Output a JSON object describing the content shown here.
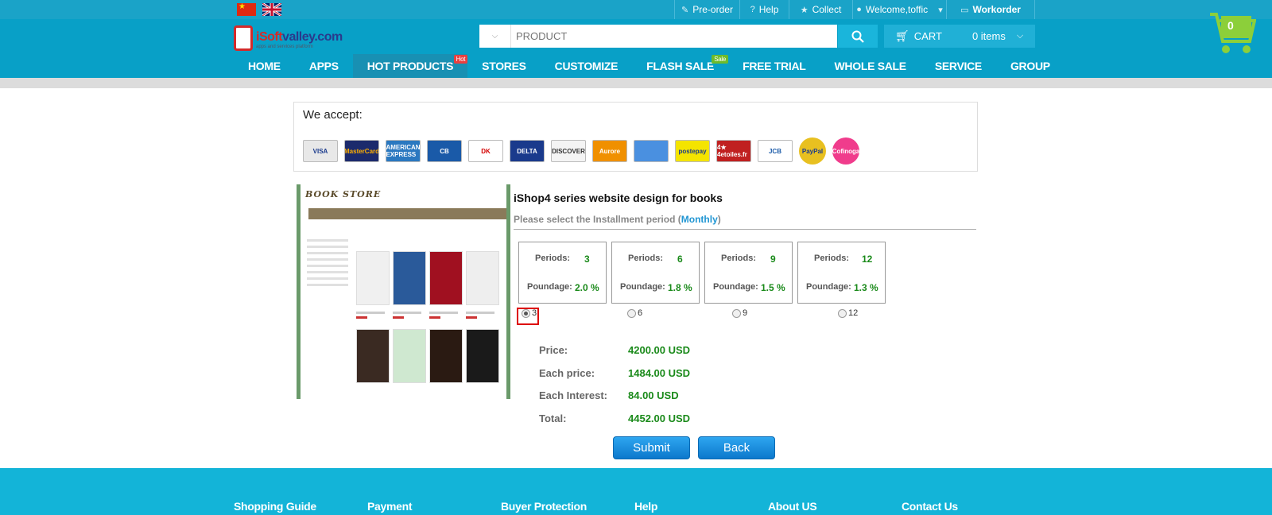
{
  "topbar": {
    "preorder": "Pre-order",
    "help": "Help",
    "collect": "Collect",
    "welcome": "Welcome,toffic",
    "workorder": "Workorder"
  },
  "brand": {
    "name_prefix": "iSoft",
    "name_rest": "valley.com",
    "tagline": "apps and services platform"
  },
  "search": {
    "placeholder": "PRODUCT"
  },
  "cart": {
    "label": "CART",
    "items": "0 items",
    "count": "0"
  },
  "nav": {
    "items": [
      "HOME",
      "APPS",
      "HOT PRODUCTS",
      "STORES",
      "CUSTOMIZE",
      "FLASH SALE",
      "FREE TRIAL",
      "WHOLE SALE",
      "SERVICE",
      "GROUP"
    ],
    "hot_badge": "Hot",
    "sale_badge": "Sale"
  },
  "accept": {
    "title": "We accept:",
    "cards": [
      {
        "label": "VISA",
        "color": "#e8e8e8",
        "text": "#1a3a8c"
      },
      {
        "label": "MasterCard",
        "color": "#1c2a6c",
        "text": "#ffb000"
      },
      {
        "label": "AMERICAN EXPRESS",
        "color": "#2a78c0",
        "text": "#ffffff"
      },
      {
        "label": "CB",
        "color": "#1a5aa8",
        "text": "#ffffff"
      },
      {
        "label": "DK",
        "color": "#ffffff",
        "text": "#d40000"
      },
      {
        "label": "DELTA",
        "color": "#1a3a8c",
        "text": "#ffffff"
      },
      {
        "label": "DISCOVER",
        "color": "#f4f4f4",
        "text": "#333333"
      },
      {
        "label": "Aurore",
        "color": "#f09000",
        "text": "#ffffff"
      },
      {
        "label": "",
        "color": "#4a90e0",
        "text": "#ffffff"
      },
      {
        "label": "postepay",
        "color": "#f4e400",
        "text": "#1a3a8c"
      },
      {
        "label": "4★ 4etoiles.fr",
        "color": "#c02020",
        "text": "#ffffff"
      },
      {
        "label": "JCB",
        "color": "#ffffff",
        "text": "#1a5aa8"
      },
      {
        "label": "PayPal",
        "color": "#e8c020",
        "text": "#1a3a8c"
      },
      {
        "label": "Cofinoga",
        "color": "#f03c8c",
        "text": "#ffffff"
      }
    ]
  },
  "preview": {
    "title": "BOOK STORE",
    "books": [
      "#f0f0f0",
      "#2a5a9a",
      "#a01020",
      "#eeeeee",
      "#3a2a22",
      "#cfe8d0",
      "#2a1a12",
      "#1a1a1a"
    ]
  },
  "product": {
    "title": "iShop4 series website design for books",
    "period_prefix": "Please select the Installment period (",
    "period_highlight": "Monthly",
    "period_suffix": ")"
  },
  "plans": [
    {
      "periods_label": "Periods:",
      "periods": "3",
      "poundage_label": "Poundage:",
      "poundage": "2.0 %"
    },
    {
      "periods_label": "Periods:",
      "periods": "6",
      "poundage_label": "Poundage:",
      "poundage": "1.8 %"
    },
    {
      "periods_label": "Periods:",
      "periods": "9",
      "poundage_label": "Poundage:",
      "poundage": "1.5 %"
    },
    {
      "periods_label": "Periods:",
      "periods": "12",
      "poundage_label": "Poundage:",
      "poundage": "1.3 %"
    }
  ],
  "radios": [
    "3",
    "6",
    "9",
    "12"
  ],
  "selected_period": "3",
  "summary": {
    "price_label": "Price:",
    "price": "4200.00 USD",
    "each_price_label": "Each price:",
    "each_price": "1484.00 USD",
    "each_interest_label": "Each Interest:",
    "each_interest": "84.00 USD",
    "total_label": "Total:",
    "total": "4452.00 USD"
  },
  "buttons": {
    "submit": "Submit",
    "back": "Back"
  },
  "footer": {
    "cols": [
      "Shopping Guide",
      "Payment",
      "Buyer Protection",
      "Help",
      "About US",
      "Contact Us"
    ]
  },
  "colors": {
    "header": "#08a0c7",
    "footer": "#13b4d8",
    "accent_green": "#1a8a1a",
    "link_blue": "#2196d3"
  }
}
